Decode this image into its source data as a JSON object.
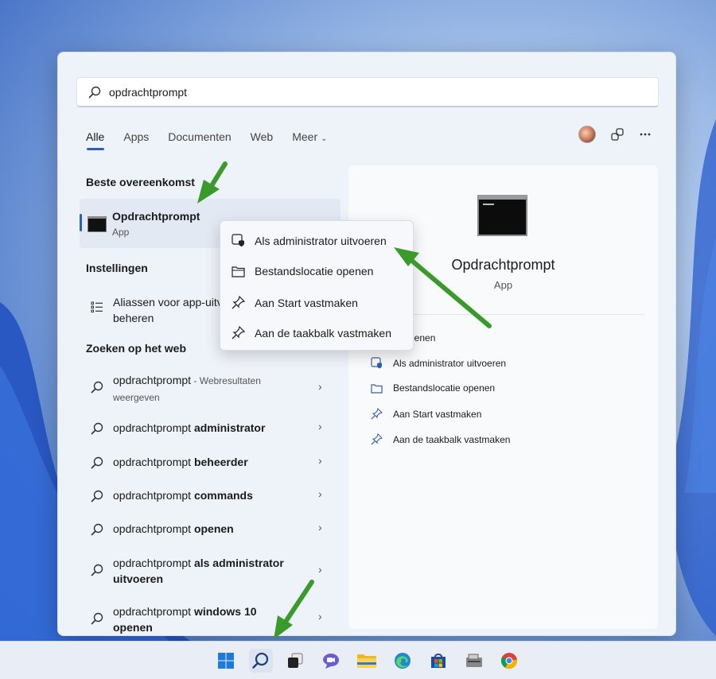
{
  "search": {
    "query": "opdrachtprompt",
    "placeholder": ""
  },
  "tabs": [
    {
      "label": "Alle",
      "active": true
    },
    {
      "label": "Apps"
    },
    {
      "label": "Documenten"
    },
    {
      "label": "Web"
    },
    {
      "label": "Meer",
      "dropdown": true
    }
  ],
  "top_icons": [
    "avatar",
    "share-icon",
    "more-icon"
  ],
  "sections": {
    "best_match": "Beste overeenkomst",
    "settings": "Instellingen",
    "web": "Zoeken op het web"
  },
  "best_match": {
    "name": "Opdrachtprompt",
    "type": "App"
  },
  "settings_item": {
    "line1": "Aliassen voor app-uitv",
    "line2": "beheren"
  },
  "web_results": [
    {
      "prefix": "opdrachtprompt",
      "suffix": " - Webresultaten",
      "line2": "weergeven"
    },
    {
      "prefix": "opdrachtprompt ",
      "bold": "administrator"
    },
    {
      "prefix": "opdrachtprompt ",
      "bold": "beheerder"
    },
    {
      "prefix": "opdrachtprompt ",
      "bold": "commands"
    },
    {
      "prefix": "opdrachtprompt ",
      "bold": "openen"
    },
    {
      "prefix": "opdrachtprompt ",
      "bold": "als administrator",
      "line2": "uitvoeren"
    },
    {
      "prefix": "opdrachtprompt ",
      "bold": "windows 10",
      "line2": "openen"
    }
  ],
  "right_pane": {
    "title": "Opdrachtprompt",
    "subtitle": "App",
    "actions": [
      {
        "label": "Openen",
        "icon": "open-icon"
      },
      {
        "label": "Als administrator uitvoeren",
        "icon": "shield-icon"
      },
      {
        "label": "Bestandslocatie openen",
        "icon": "folder-icon"
      },
      {
        "label": "Aan Start vastmaken",
        "icon": "pin-icon"
      },
      {
        "label": "Aan de taakbalk vastmaken",
        "icon": "pin-icon"
      }
    ],
    "visible_first_action": "penen"
  },
  "context_menu": [
    {
      "label": "Als administrator uitvoeren",
      "icon": "shield-icon"
    },
    {
      "label": "Bestandslocatie openen",
      "icon": "folder-icon"
    },
    {
      "label": "Aan Start vastmaken",
      "icon": "pin-icon"
    },
    {
      "label": "Aan de taakbalk vastmaken",
      "icon": "pin-icon"
    }
  ],
  "taskbar": [
    "windows-start-icon",
    "search-icon",
    "task-view-icon",
    "teams-chat-icon",
    "file-explorer-icon",
    "edge-icon",
    "store-icon",
    "app-icon",
    "chrome-icon"
  ],
  "colors": {
    "accent": "#2b5fb8",
    "arrow": "#3a9a2a"
  }
}
